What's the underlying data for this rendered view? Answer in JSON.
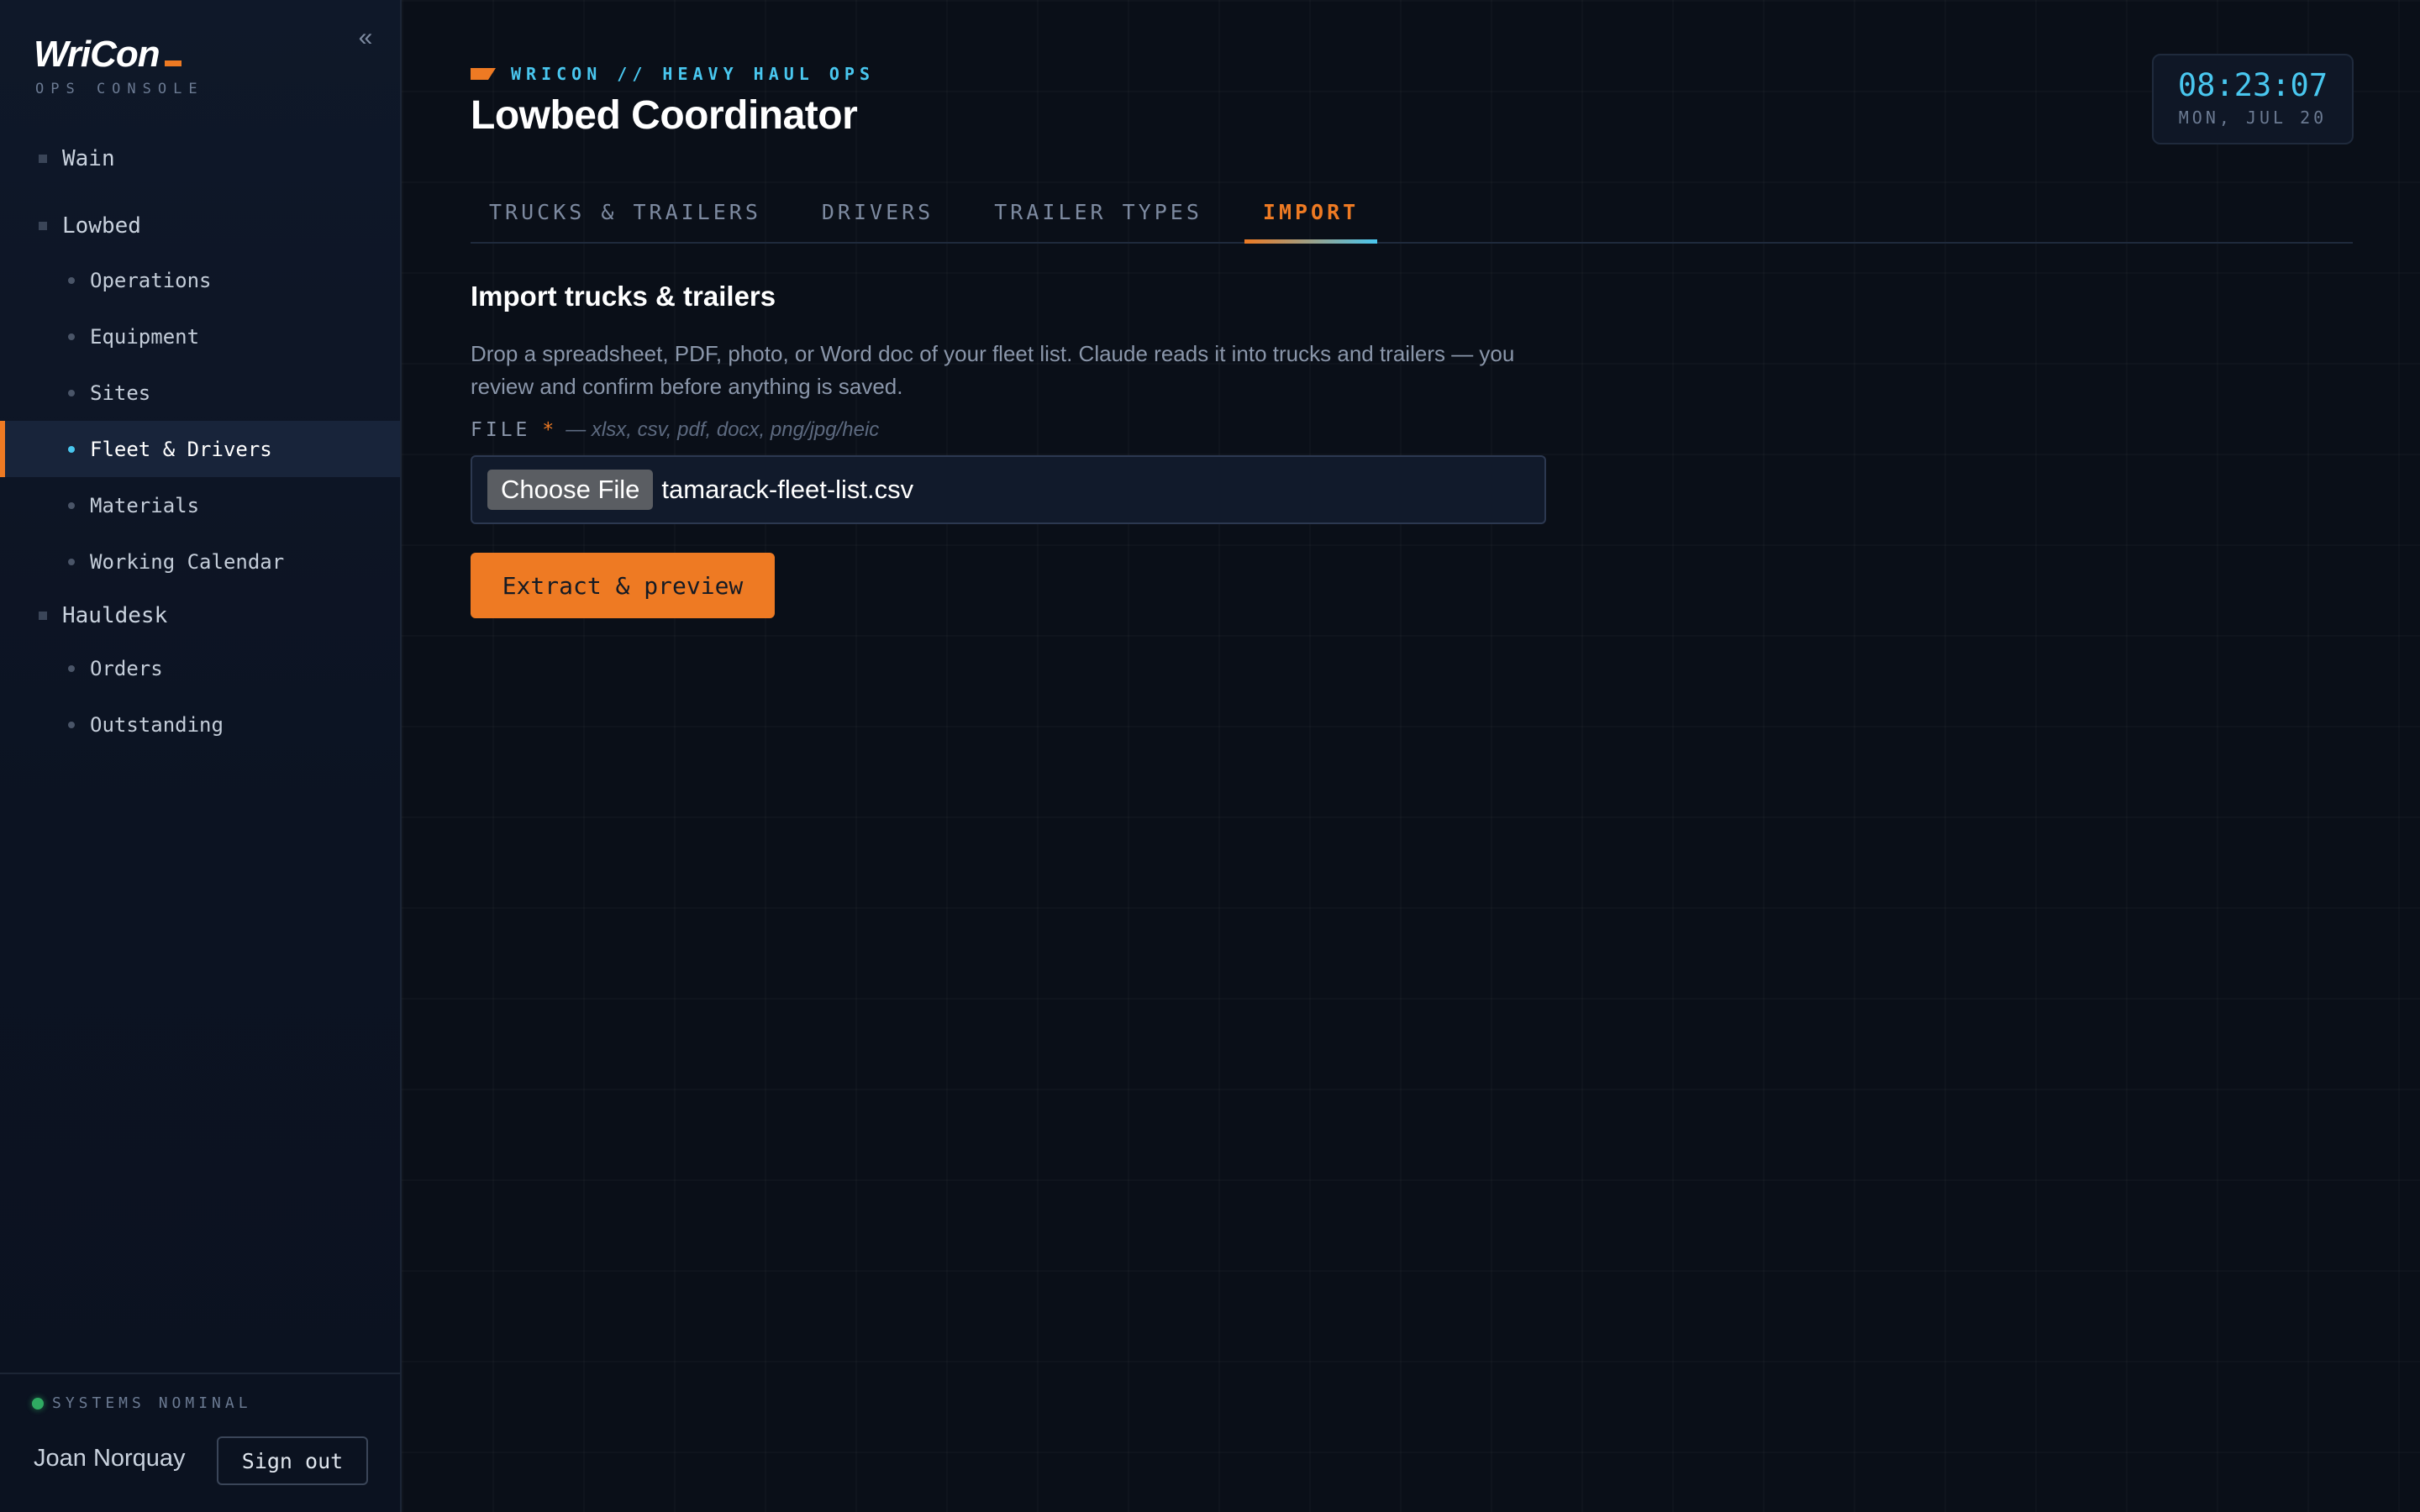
{
  "sidebar": {
    "brand": {
      "logo": "WriCon",
      "subtitle": "OPS CONSOLE"
    },
    "collapse_icon": "«",
    "groups": [
      {
        "label": "Wain",
        "items": []
      },
      {
        "label": "Lowbed",
        "items": [
          {
            "label": "Operations"
          },
          {
            "label": "Equipment"
          },
          {
            "label": "Sites"
          },
          {
            "label": "Fleet & Drivers",
            "active": true
          },
          {
            "label": "Materials"
          },
          {
            "label": "Working Calendar"
          }
        ]
      },
      {
        "label": "Hauldesk",
        "items": [
          {
            "label": "Orders"
          },
          {
            "label": "Outstanding"
          }
        ]
      }
    ],
    "footer": {
      "status": "SYSTEMS NOMINAL",
      "user": "Joan Norquay",
      "sign_out": "Sign out"
    }
  },
  "header": {
    "eyebrow": "WRICON // HEAVY HAUL OPS",
    "title": "Lowbed Coordinator",
    "clock": {
      "time": "08:23:07",
      "date": "MON, JUL 20"
    }
  },
  "tabs": [
    {
      "label": "TRUCKS & TRAILERS"
    },
    {
      "label": "DRIVERS"
    },
    {
      "label": "TRAILER TYPES"
    },
    {
      "label": "IMPORT",
      "active": true
    }
  ],
  "import": {
    "title": "Import trucks & trailers",
    "description": "Drop a spreadsheet, PDF, photo, or Word doc of your fleet list. Claude reads it into trucks and trailers — you review and confirm before anything is saved.",
    "file_label": "FILE",
    "required_mark": "*",
    "file_hint": "— xlsx, csv, pdf, docx, png/jpg/heic",
    "choose_file": "Choose File",
    "file_name": "tamarack-fleet-list.csv",
    "submit": "Extract & preview"
  },
  "colors": {
    "accent": "#ee7a23",
    "cyan": "#49c7ef",
    "status_ok": "#2faa62",
    "background": "#0a0f18"
  }
}
